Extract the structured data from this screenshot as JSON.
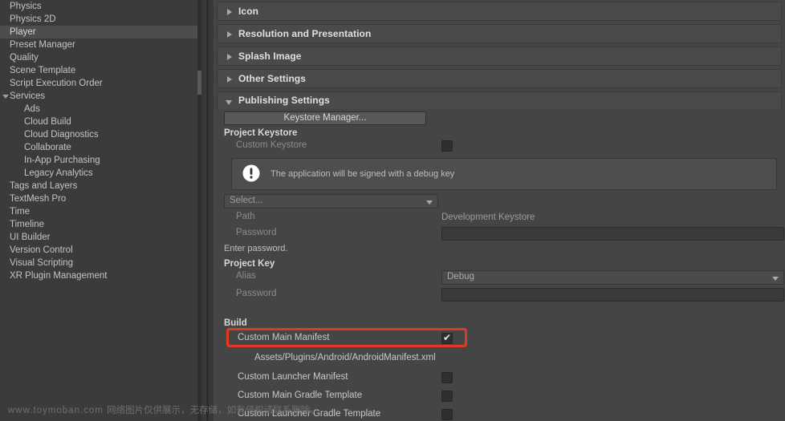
{
  "sidebar": {
    "items": [
      {
        "label": "Physics",
        "indent": false,
        "selected": false,
        "arrow": "none"
      },
      {
        "label": "Physics 2D",
        "indent": false,
        "selected": false,
        "arrow": "none"
      },
      {
        "label": "Player",
        "indent": false,
        "selected": true,
        "arrow": "none"
      },
      {
        "label": "Preset Manager",
        "indent": false,
        "selected": false,
        "arrow": "none"
      },
      {
        "label": "Quality",
        "indent": false,
        "selected": false,
        "arrow": "none"
      },
      {
        "label": "Scene Template",
        "indent": false,
        "selected": false,
        "arrow": "none"
      },
      {
        "label": "Script Execution Order",
        "indent": false,
        "selected": false,
        "arrow": "none"
      },
      {
        "label": "Services",
        "indent": false,
        "selected": false,
        "arrow": "down"
      },
      {
        "label": "Ads",
        "indent": true,
        "selected": false,
        "arrow": "none"
      },
      {
        "label": "Cloud Build",
        "indent": true,
        "selected": false,
        "arrow": "none"
      },
      {
        "label": "Cloud Diagnostics",
        "indent": true,
        "selected": false,
        "arrow": "none"
      },
      {
        "label": "Collaborate",
        "indent": true,
        "selected": false,
        "arrow": "none"
      },
      {
        "label": "In-App Purchasing",
        "indent": true,
        "selected": false,
        "arrow": "none"
      },
      {
        "label": "Legacy Analytics",
        "indent": true,
        "selected": false,
        "arrow": "none"
      },
      {
        "label": "Tags and Layers",
        "indent": false,
        "selected": false,
        "arrow": "none"
      },
      {
        "label": "TextMesh Pro",
        "indent": false,
        "selected": false,
        "arrow": "none"
      },
      {
        "label": "Time",
        "indent": false,
        "selected": false,
        "arrow": "none"
      },
      {
        "label": "Timeline",
        "indent": false,
        "selected": false,
        "arrow": "none"
      },
      {
        "label": "UI Builder",
        "indent": false,
        "selected": false,
        "arrow": "none"
      },
      {
        "label": "Version Control",
        "indent": false,
        "selected": false,
        "arrow": "none"
      },
      {
        "label": "Visual Scripting",
        "indent": false,
        "selected": false,
        "arrow": "none"
      },
      {
        "label": "XR Plugin Management",
        "indent": false,
        "selected": false,
        "arrow": "none"
      }
    ]
  },
  "main": {
    "foldouts": [
      {
        "label": "Icon",
        "expanded": false
      },
      {
        "label": "Resolution and Presentation",
        "expanded": false
      },
      {
        "label": "Splash Image",
        "expanded": false
      },
      {
        "label": "Other Settings",
        "expanded": false
      },
      {
        "label": "Publishing Settings",
        "expanded": true
      }
    ],
    "publishing": {
      "keystore_manager_button": "Keystore Manager...",
      "project_keystore_label": "Project Keystore",
      "custom_keystore_label": "Custom Keystore",
      "custom_keystore_checked": false,
      "info_message": "The application will be signed with a debug key",
      "keystore_select_placeholder": "Select...",
      "path_label": "Path",
      "path_value": "Development Keystore",
      "keystore_password_label": "Password",
      "password_hint": "Enter password.",
      "project_key_label": "Project Key",
      "alias_label": "Alias",
      "alias_value": "Debug",
      "key_password_label": "Password",
      "build_label": "Build",
      "custom_main_manifest_label": "Custom Main Manifest",
      "custom_main_manifest_checked": true,
      "manifest_path": "Assets/Plugins/Android/AndroidManifest.xml",
      "custom_launcher_manifest_label": "Custom Launcher Manifest",
      "custom_launcher_manifest_checked": false,
      "custom_main_gradle_label": "Custom Main Gradle Template",
      "custom_main_gradle_checked": false,
      "custom_launcher_gradle_label": "Custom Launcher Gradle Template",
      "custom_launcher_gradle_checked": false
    }
  },
  "watermark": {
    "url": "www.toymoban.com ",
    "notice": "网络图片仅供展示，无存储，如有侵权请联系删除。"
  },
  "colors": {
    "panel_bg": "#454545",
    "sidebar_bg": "#3b3b3b",
    "selection": "#4d4d4d",
    "highlight_red": "#e03a20",
    "foldout_bg": "#4a4a4a"
  }
}
